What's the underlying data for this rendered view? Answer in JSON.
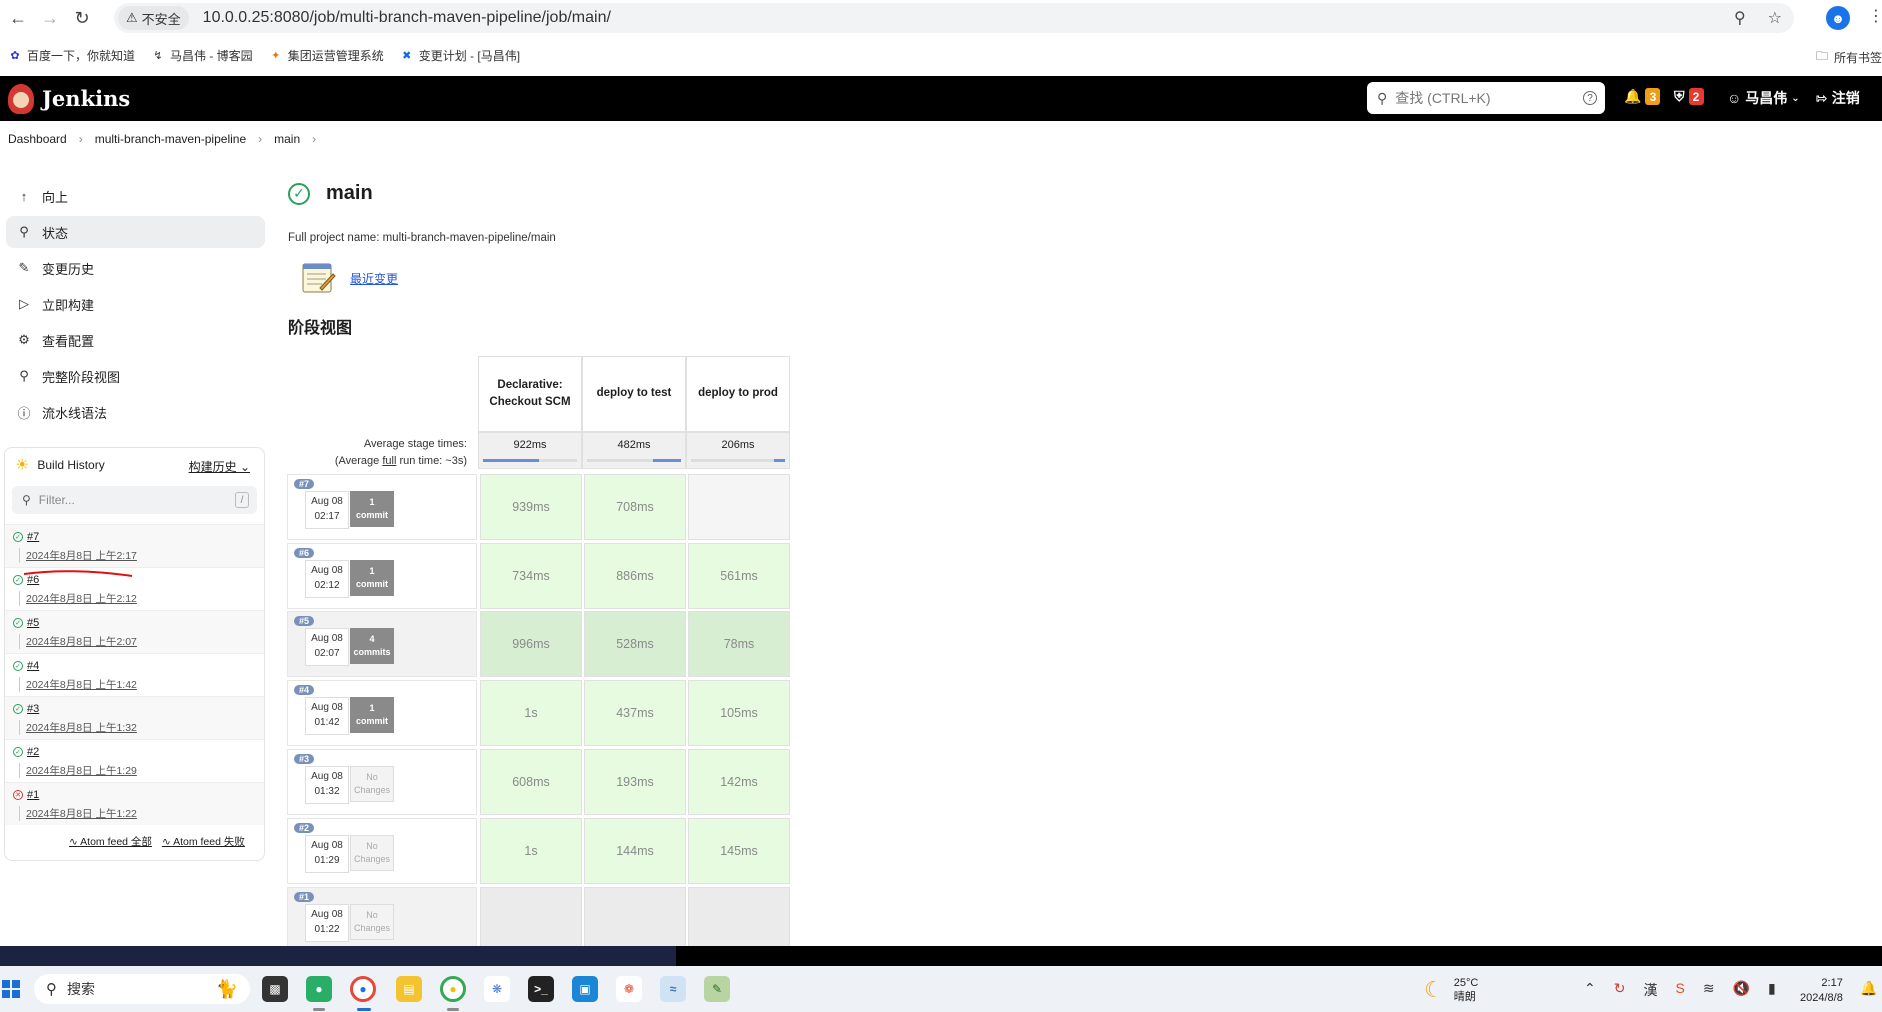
{
  "browser": {
    "insecure_label": "不安全",
    "url": "10.0.0.25:8080/job/multi-branch-maven-pipeline/job/main/",
    "bookmarks": [
      {
        "label": "百度一下，你就知道",
        "icon": "baidu-icon"
      },
      {
        "label": "马昌伟 - 博客园",
        "icon": "cnblogs-icon"
      },
      {
        "label": "集团运营管理系统",
        "icon": "system-icon"
      },
      {
        "label": "变更计划 - [马昌伟]",
        "icon": "confluence-icon"
      }
    ],
    "all_bookmarks": "所有书签"
  },
  "header": {
    "brand": "Jenkins",
    "search_placeholder": "查找 (CTRL+K)",
    "notifications_count": "3",
    "security_count": "2",
    "user": "马昌伟",
    "logout": "注销",
    "notif_color": "#f29d16",
    "security_color": "#e63a2e"
  },
  "breadcrumb": [
    "Dashboard",
    "multi-branch-maven-pipeline",
    "main"
  ],
  "sidebar": {
    "tasks": [
      {
        "label": "向上",
        "icon": "arrow-up-icon"
      },
      {
        "label": "状态",
        "icon": "search-icon",
        "active": true
      },
      {
        "label": "变更历史",
        "icon": "notepad-icon"
      },
      {
        "label": "立即构建",
        "icon": "play-icon"
      },
      {
        "label": "查看配置",
        "icon": "gear-icon"
      },
      {
        "label": "完整阶段视图",
        "icon": "search-icon"
      },
      {
        "label": "流水线语法",
        "icon": "help-icon"
      }
    ]
  },
  "build_history": {
    "title": "Build History",
    "trend_label": "构建历史",
    "filter_placeholder": "Filter...",
    "filter_shortcut": "/",
    "builds": [
      {
        "number": "#7",
        "date": "2024年8月8日 上午2:17",
        "status": "success"
      },
      {
        "number": "#6",
        "date": "2024年8月8日 上午2:12",
        "status": "success"
      },
      {
        "number": "#5",
        "date": "2024年8月8日 上午2:07",
        "status": "success"
      },
      {
        "number": "#4",
        "date": "2024年8月8日 上午1:42",
        "status": "success"
      },
      {
        "number": "#3",
        "date": "2024年8月8日 上午1:32",
        "status": "success"
      },
      {
        "number": "#2",
        "date": "2024年8月8日 上午1:29",
        "status": "success"
      },
      {
        "number": "#1",
        "date": "2024年8月8日 上午1:22",
        "status": "failed"
      }
    ],
    "feed_all": "Atom feed 全部",
    "feed_failed": "Atom feed 失败"
  },
  "main": {
    "title": "main",
    "full_name": "Full project name: multi-branch-maven-pipeline/main",
    "recent_changes": "最近变更",
    "stage_view_heading": "阶段视图"
  },
  "stage_view": {
    "avg_label_1": "Average stage times:",
    "avg_label_2a": "(Average ",
    "avg_label_2b": "full",
    "avg_label_2c": " run time: ~3s)",
    "stages": [
      {
        "name": "Declarative: Checkout SCM",
        "avg": "922ms",
        "avg_fraction": 0.6
      },
      {
        "name": "deploy to test",
        "avg": "482ms",
        "avg_fraction": 0.3
      },
      {
        "name": "deploy to prod",
        "avg": "206ms",
        "avg_fraction": 0.12
      }
    ],
    "builds": [
      {
        "number": "#7",
        "date": "Aug 08",
        "time": "02:17",
        "changes": "1\ncommit",
        "has_changes": true,
        "times": [
          "939ms",
          "708ms",
          ""
        ]
      },
      {
        "number": "#6",
        "date": "Aug 08",
        "time": "02:12",
        "changes": "1\ncommit",
        "has_changes": true,
        "times": [
          "734ms",
          "886ms",
          "561ms"
        ]
      },
      {
        "number": "#5",
        "date": "Aug 08",
        "time": "02:07",
        "changes": "4\ncommits",
        "has_changes": true,
        "times": [
          "996ms",
          "528ms",
          "78ms"
        ]
      },
      {
        "number": "#4",
        "date": "Aug 08",
        "time": "01:42",
        "changes": "1\ncommit",
        "has_changes": true,
        "times": [
          "1s",
          "437ms",
          "105ms"
        ]
      },
      {
        "number": "#3",
        "date": "Aug 08",
        "time": "01:32",
        "changes": "No\nChanges",
        "has_changes": false,
        "times": [
          "608ms",
          "193ms",
          "142ms"
        ]
      },
      {
        "number": "#2",
        "date": "Aug 08",
        "time": "01:29",
        "changes": "No\nChanges",
        "has_changes": false,
        "times": [
          "1s",
          "144ms",
          "145ms"
        ]
      },
      {
        "number": "#1",
        "date": "Aug 08",
        "time": "01:22",
        "changes": "No\nChanges",
        "has_changes": false,
        "times": [
          "",
          "",
          ""
        ]
      }
    ]
  },
  "taskbar": {
    "search_label": "搜索",
    "weather_temp": "25°C",
    "weather_desc": "晴朗",
    "time": "2:17",
    "date": "2024/8/8"
  }
}
